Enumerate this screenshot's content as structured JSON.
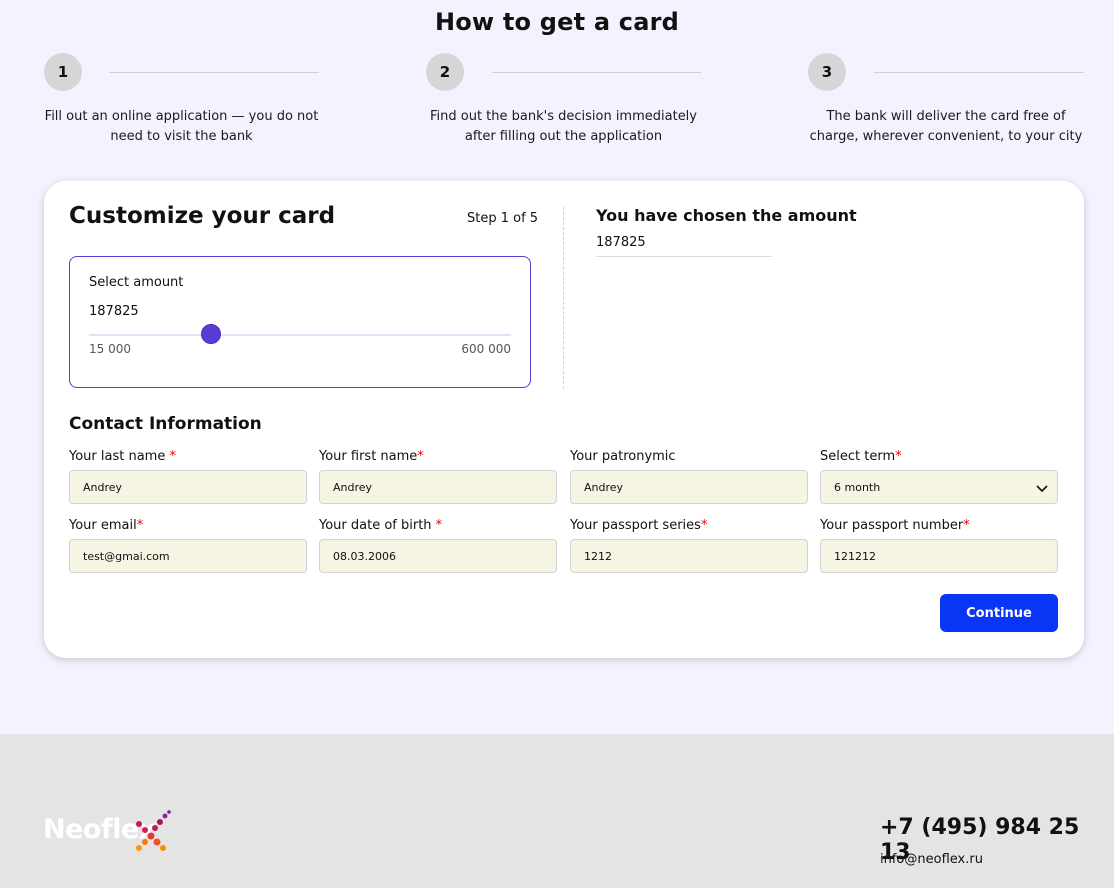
{
  "page": {
    "title": "How to get a card"
  },
  "steps": [
    {
      "number": "1",
      "text": "Fill out an online application — you do not need to visit the bank"
    },
    {
      "number": "2",
      "text": "Find out the bank's decision immediately after filling out the application"
    },
    {
      "number": "3",
      "text": "The bank will deliver the card free of charge, wherever convenient, to your city"
    }
  ],
  "card": {
    "title": "Customize your card",
    "step_indicator": "Step 1 of 5",
    "amount": {
      "label": "Select amount",
      "value": "187825",
      "min_label": "15 000",
      "max_label": "600 000",
      "slider_fraction": 0.29
    },
    "chosen": {
      "title": "You have chosen the amount",
      "value": "187825"
    },
    "contact": {
      "title": "Contact Information",
      "fields": [
        {
          "label": "Your last name ",
          "required": true,
          "value": "Andrey"
        },
        {
          "label": "Your first name",
          "required": true,
          "value": "Andrey"
        },
        {
          "label": "Your patronymic",
          "required": false,
          "value": "Andrey"
        },
        {
          "label": "Select term",
          "required": true,
          "value": "6 month"
        },
        {
          "label": "Your email",
          "required": true,
          "value": "test@gmai.com"
        },
        {
          "label": "Your date of birth ",
          "required": true,
          "value": "08.03.2006"
        },
        {
          "label": "Your passport series",
          "required": true,
          "value": "1212"
        },
        {
          "label": "Your passport number",
          "required": true,
          "value": "121212"
        }
      ],
      "required_marker": "*"
    },
    "continue_label": "Continue"
  },
  "footer": {
    "logo_text": "Neoflex",
    "phone": "+7 (495) 984 25 13",
    "email": "info@neoflex.ru"
  },
  "colors": {
    "accent": "#5b3bd6",
    "button": "#0a35f5",
    "input_bg": "#f6f4e3",
    "page_bg": "#f3f2fe",
    "footer_bg": "#e4e4e4",
    "required": "#e00000"
  },
  "icons": {
    "select_chevron": "chevron-down-icon",
    "logo_mark": "neoflex-x-logo"
  }
}
